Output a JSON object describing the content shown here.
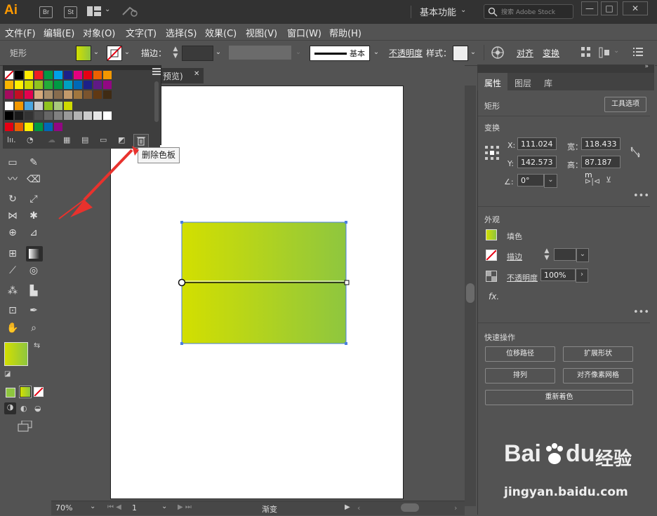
{
  "app": {
    "logo": "Ai",
    "bridge": "Br",
    "stock": "St",
    "workspace": "基本功能",
    "search_placeholder": "搜索 Adobe Stock",
    "min": "—",
    "max": "□",
    "close": "✕"
  },
  "menu": [
    "文件(F)",
    "编辑(E)",
    "对象(O)",
    "文字(T)",
    "选择(S)",
    "效果(C)",
    "视图(V)",
    "窗口(W)",
    "帮助(H)"
  ],
  "control": {
    "object_type": "矩形",
    "stroke_label": "描边：",
    "brush_label": "基本",
    "opacity_label": "不透明度",
    "style_label": "样式：",
    "align_label": "对齐",
    "transform_label": "变换"
  },
  "document": {
    "tab_suffix": "预览)",
    "tab_close": "✕",
    "zoom": "70%",
    "page": "1",
    "status": "渐变"
  },
  "swatches": {
    "none_label": "[无]",
    "tooltip": "删除色板",
    "rows": [
      [
        "#ffffff",
        "#000000",
        "#ffeb00",
        "#ed1c24",
        "#009944",
        "#00a0e9",
        "#1d2088",
        "#e4007f",
        "#e60012",
        "#eb6100",
        "#f39800"
      ],
      [
        "#f8b500",
        "#fff100",
        "#cfdb00",
        "#8fc31f",
        "#22ac38",
        "#009944",
        "#00a0c1",
        "#0068b7",
        "#1d2088",
        "#601986",
        "#920783"
      ],
      [
        "#a40b5d",
        "#c30d23",
        "#e5004f",
        "#d7a97a",
        "#a98e6b",
        "#876c4e",
        "#c39a6b",
        "#a0763e",
        "#7a542e",
        "#603813",
        "#3f2b14"
      ],
      [
        "#ffffff",
        "#f39800",
        "#4aa5e0",
        "#cccccc",
        "#8fc31f",
        "#a9c97d",
        "#cfdb00"
      ],
      [
        "#000000",
        "#1a1a1a",
        "#333333",
        "#4d4d4d",
        "#666666",
        "#808080",
        "#999999",
        "#b3b3b3",
        "#cccccc",
        "#e6e6e6",
        "#ffffff"
      ],
      [
        "#e60012",
        "#eb6100",
        "#fff100",
        "#009944",
        "#0068b7",
        "#920783"
      ]
    ]
  },
  "properties": {
    "tabs": [
      "属性",
      "图层",
      "库"
    ],
    "section_object": "矩形",
    "tool_options": "工具选项",
    "transform": "变换",
    "x": "111.024",
    "y": "142.573",
    "w": "118.433",
    "h": "87.187 m",
    "x_label": "X:",
    "y_label": "Y:",
    "w_label": "宽：",
    "h_label": "高：",
    "angle": "0°",
    "appearance": "外观",
    "fill": "填色",
    "stroke": "描边",
    "opacity_label": "不透明度",
    "opacity": "100%",
    "fx": "fx.",
    "quick_actions": "快速操作",
    "offset_path": "位移路径",
    "expand": "扩展形状",
    "arrange": "排列",
    "align_pixel": "对齐像素网格",
    "recolor": "重新着色"
  },
  "watermark": {
    "brand": "Bai",
    "brand2": "du",
    "suffix": "经验",
    "url": "jingyan.baidu.com"
  },
  "colors": {
    "fill_start": "#d3df00",
    "fill_end": "#8ec63f",
    "accent": "#ff9a00",
    "arrow": "#e8322d"
  }
}
